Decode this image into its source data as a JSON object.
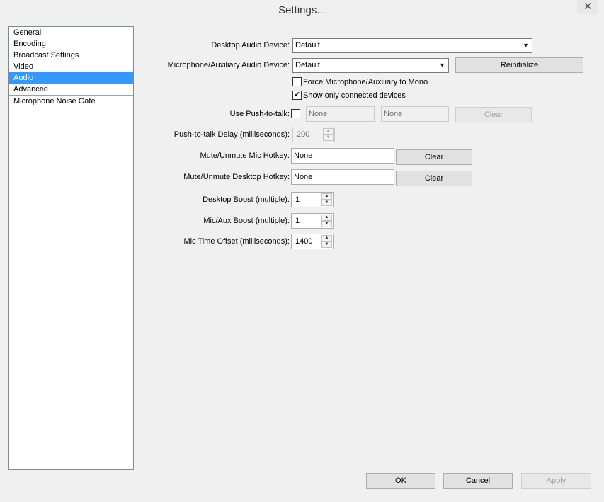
{
  "window": {
    "title": "Settings...",
    "close_glyph": "✕"
  },
  "sidebar": {
    "items": [
      {
        "label": "General"
      },
      {
        "label": "Encoding"
      },
      {
        "label": "Broadcast Settings"
      },
      {
        "label": "Video"
      },
      {
        "label": "Audio",
        "selected": true
      },
      {
        "label": "Advanced"
      },
      {
        "label": "Microphone Noise Gate"
      }
    ]
  },
  "audio": {
    "desktop_device_label": "Desktop Audio Device:",
    "desktop_device_value": "Default",
    "mic_device_label": "Microphone/Auxiliary Audio Device:",
    "mic_device_value": "Default",
    "reinitialize_label": "Reinitialize",
    "force_mono_label": "Force Microphone/Auxiliary to Mono",
    "force_mono_checked": false,
    "show_connected_label": "Show only connected devices",
    "show_connected_checked": true,
    "push_to_talk_label": "Use Push-to-talk:",
    "push_to_talk_checked": false,
    "ptt_hotkey1": "None",
    "ptt_hotkey2": "None",
    "ptt_clear_label": "Clear",
    "ptt_delay_label": "Push-to-talk Delay (milliseconds):",
    "ptt_delay_value": "200",
    "mute_mic_label": "Mute/Unmute Mic Hotkey:",
    "mute_mic_value": "None",
    "mute_mic_clear_label": "Clear",
    "mute_desktop_label": "Mute/Unmute Desktop Hotkey:",
    "mute_desktop_value": "None",
    "mute_desktop_clear_label": "Clear",
    "desktop_boost_label": "Desktop Boost (multiple):",
    "desktop_boost_value": "1",
    "mic_boost_label": "Mic/Aux Boost (multiple):",
    "mic_boost_value": "1",
    "mic_offset_label": "Mic Time Offset (milliseconds):",
    "mic_offset_value": "1400"
  },
  "footer": {
    "ok_label": "OK",
    "cancel_label": "Cancel",
    "apply_label": "Apply"
  },
  "icons": {
    "dropdown": "▼",
    "spin_up": "▲",
    "spin_down": "▼",
    "check": "✔"
  }
}
